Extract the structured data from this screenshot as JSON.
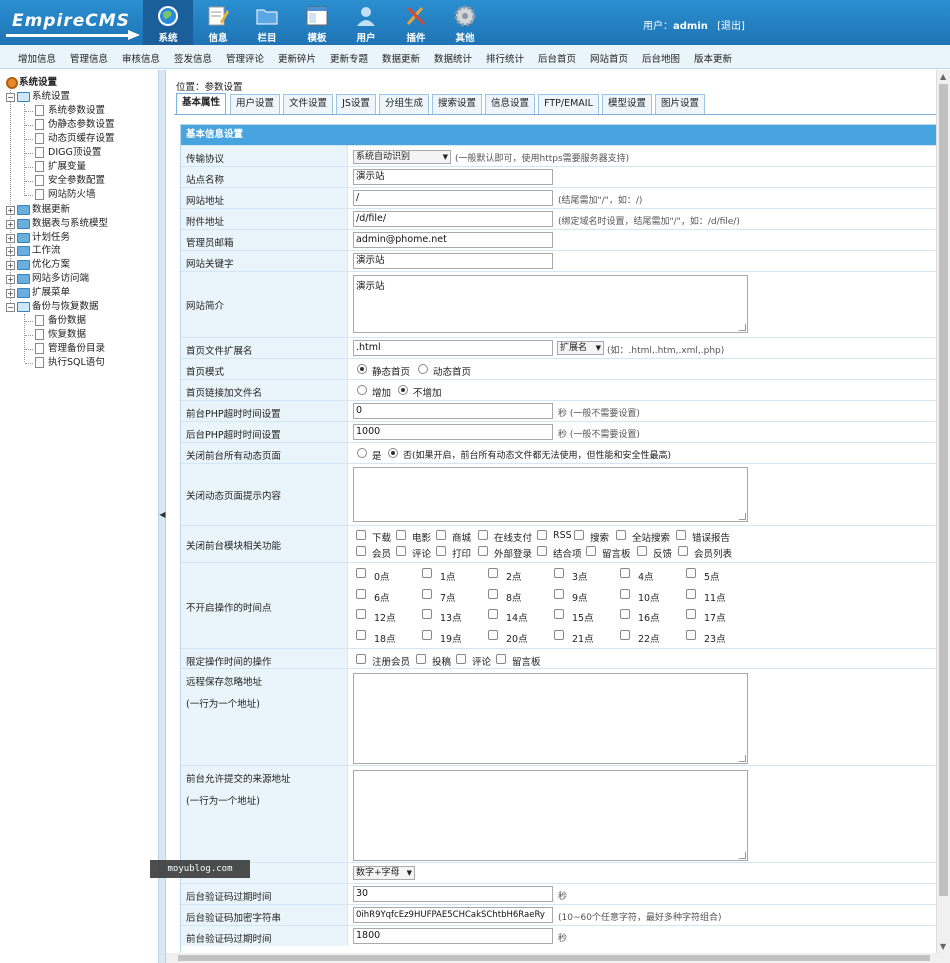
{
  "header": {
    "logo": "EmpireCMS",
    "nav": [
      {
        "label": "系统",
        "icon": "globe-icon",
        "active": true
      },
      {
        "label": "信息",
        "icon": "pencil-note-icon"
      },
      {
        "label": "栏目",
        "icon": "folder-icon"
      },
      {
        "label": "模板",
        "icon": "window-template-icon"
      },
      {
        "label": "用户",
        "icon": "user-icon"
      },
      {
        "label": "插件",
        "icon": "tools-icon"
      },
      {
        "label": "其他",
        "icon": "gear-icon"
      }
    ],
    "user_prefix": "用户：",
    "username": "admin",
    "logout": "[退出]"
  },
  "menubar": [
    "增加信息",
    "管理信息",
    "审核信息",
    "签发信息",
    "管理评论",
    "更新碎片",
    "更新专题",
    "数据更新",
    "数据统计",
    "排行统计",
    "后台首页",
    "网站首页",
    "后台地图",
    "版本更新"
  ],
  "sidebar": {
    "root": "系统设置",
    "groups": [
      {
        "label": "系统设置",
        "open": true,
        "items": [
          "系统参数设置",
          "伪静态参数设置",
          "动态页缓存设置",
          "DIGG顶设置",
          "扩展变量",
          "安全参数配置",
          "网站防火墙"
        ]
      },
      {
        "label": "数据更新"
      },
      {
        "label": "数据表与系统模型"
      },
      {
        "label": "计划任务"
      },
      {
        "label": "工作流"
      },
      {
        "label": "优化方案"
      },
      {
        "label": "网站多访问端"
      },
      {
        "label": "扩展菜单"
      },
      {
        "label": "备份与恢复数据",
        "open": true,
        "items": [
          "备份数据",
          "恢复数据",
          "管理备份目录",
          "执行SQL语句"
        ]
      }
    ]
  },
  "main": {
    "location_prefix": "位置：",
    "location": "参数设置",
    "tabs": [
      "基本属性",
      "用户设置",
      "文件设置",
      "JS设置",
      "分组生成",
      "搜索设置",
      "信息设置",
      "FTP/EMAIL",
      "模型设置",
      "图片设置"
    ],
    "form_title": "基本信息设置",
    "fields": {
      "protocol": {
        "label": "传输协议",
        "value": "系统自动识别",
        "hint": "(一般默认即可，使用https需要服务器支持)"
      },
      "sitename": {
        "label": "站点名称",
        "value": "演示站"
      },
      "siteurl": {
        "label": "网站地址",
        "value": "/",
        "hint": "(结尾需加\"/\"，如：/)"
      },
      "fileurl": {
        "label": "附件地址",
        "value": "/d/file/",
        "hint": "(绑定域名时设置，结尾需加\"/\"，如：/d/file/)"
      },
      "email": {
        "label": "管理员邮箱",
        "value": "admin@phome.net"
      },
      "keywords": {
        "label": "网站关键字",
        "value": "演示站"
      },
      "intro": {
        "label": "网站简介",
        "value": "演示站"
      },
      "indexext": {
        "label": "首页文件扩展名",
        "value": ".html",
        "select": "扩展名",
        "hint": "(如：.html,.htm,.xml,.php)"
      },
      "indexmode": {
        "label": "首页模式",
        "opt1": "静态首页",
        "opt2": "动态首页",
        "selected": 1
      },
      "indexlink": {
        "label": "首页链接加文件名",
        "opt1": "增加",
        "opt2": "不增加",
        "selected": 2
      },
      "phptimeout": {
        "label": "前台PHP超时时间设置",
        "value": "0",
        "hint": "秒 (一般不需要设置)"
      },
      "adminphptimeout": {
        "label": "后台PHP超时时间设置",
        "value": "1000",
        "hint": "秒 (一般不需要设置)"
      },
      "closedynamic": {
        "label": "关闭前台所有动态页面",
        "opt1": "是",
        "opt2": "否(如果开启，前台所有动态文件都无法使用，但性能和安全性最高)",
        "selected": 2
      },
      "closemsg": {
        "label": "关闭动态页面提示内容"
      },
      "closemods": {
        "label": "关闭前台模块相关功能",
        "row1": [
          "下载",
          "电影",
          "商城",
          "在线支付",
          "RSS",
          "搜索",
          "全站搜索",
          "错误报告"
        ],
        "row2": [
          "会员",
          "评论",
          "打印",
          "外部登录",
          "结合项",
          "留言板",
          "反馈",
          "会员列表"
        ]
      },
      "closehours": {
        "label": "不开启操作的时间点",
        "hours": [
          "0点",
          "1点",
          "2点",
          "3点",
          "4点",
          "5点",
          "6点",
          "7点",
          "8点",
          "9点",
          "10点",
          "11点",
          "12点",
          "13点",
          "14点",
          "15点",
          "16点",
          "17点",
          "18点",
          "19点",
          "20点",
          "21点",
          "22点",
          "23点"
        ]
      },
      "limitops": {
        "label": "限定操作时间的操作",
        "items": [
          "注册会员",
          "投稿",
          "评论",
          "留言板"
        ]
      },
      "remoteignore": {
        "label": "远程保存忽略地址",
        "sub": "(一行为一个地址)"
      },
      "allowfrom": {
        "label": "前台允许提交的来源地址",
        "sub": "(一行为一个地址)"
      },
      "captchatype": {
        "value": "数字+字母"
      },
      "captchaexpire": {
        "label": "后台验证码过期时间",
        "value": "30",
        "hint": "秒"
      },
      "captchakey": {
        "label": "后台验证码加密字符串",
        "value": "0ihR9YqfcEz9HUFPAE5CHCakSChtbH6RaeRy",
        "hint": "(10~60个任意字符，最好多种字符组合)"
      },
      "frontcaptchaexpire": {
        "label": "前台验证码过期时间",
        "value": "1800",
        "hint": "秒"
      }
    }
  },
  "watermark": "moyublog.com"
}
